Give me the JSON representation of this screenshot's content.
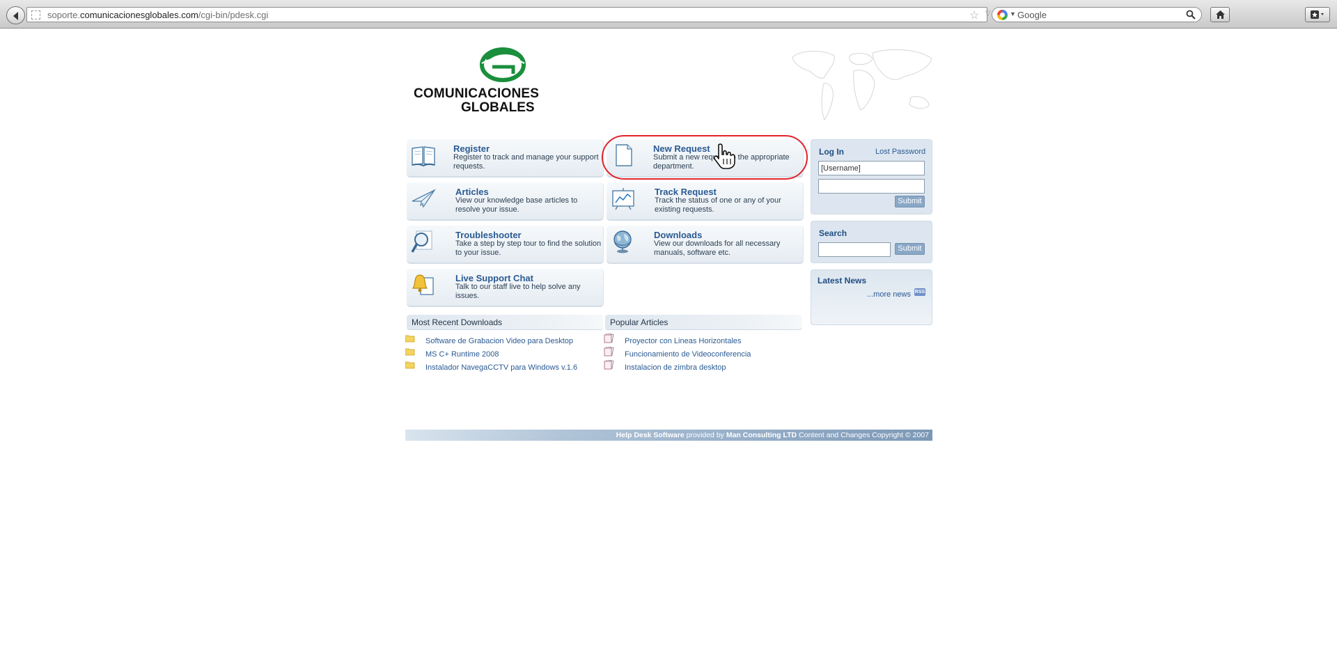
{
  "browser": {
    "url_prefix": "soporte.",
    "url_host": "comunicacionesglobales.com",
    "url_path": "/cgi-bin/pdesk.cgi",
    "search_placeholder": "Google"
  },
  "logo": {
    "line1": "COMUNICACIONES",
    "line2": "GLOBALES",
    "brand_color": "#1a8f3c"
  },
  "tiles": [
    {
      "title": "Register",
      "desc": "Register to track and manage your support requests.",
      "icon": "book-icon"
    },
    {
      "title": "New Request",
      "desc": "Submit a new request to the appropriate department.",
      "icon": "document-icon"
    },
    {
      "title": "Articles",
      "desc": "View our knowledge base articles to resolve your issue.",
      "icon": "paper-plane-icon"
    },
    {
      "title": "Track Request",
      "desc": "Track the status of one or any of your existing requests.",
      "icon": "chart-board-icon"
    },
    {
      "title": "Troubleshooter",
      "desc": "Take a step by step tour to find the solution to your issue.",
      "icon": "magnifier-icon"
    },
    {
      "title": "Downloads",
      "desc": "View our downloads for all necessary manuals, software etc.",
      "icon": "globe-icon"
    },
    {
      "title": "Live Support Chat",
      "desc": "Talk to our staff live to help solve any issues.",
      "icon": "bell-icon"
    }
  ],
  "login": {
    "title": "Log In",
    "lost_password": "Lost Password",
    "username_value": "[Username]",
    "password_value": "",
    "submit": "Submit"
  },
  "search": {
    "title": "Search",
    "value": "",
    "submit": "Submit"
  },
  "news": {
    "title": "Latest News",
    "more": "...more news",
    "rss": "RSS"
  },
  "downloads": {
    "heading": "Most Recent Downloads",
    "items": [
      "Software de Grabacion Video para Desktop",
      "MS C+ Runtime 2008",
      "Instalador NavegaCCTV para Windows v.1.6"
    ]
  },
  "articles": {
    "heading": "Popular Articles",
    "items": [
      "Proyector con Lineas Horizontales",
      "Funcionamiento de Videoconferencia",
      "Instalacion de zimbra desktop"
    ]
  },
  "footer": {
    "part1": "Help Desk Software",
    "part2": " provided by ",
    "part3": "Man Consulting LTD",
    "part4": " Content and Changes Copyright © 2007"
  },
  "annotation": {
    "ring_color": "#e0232b"
  }
}
